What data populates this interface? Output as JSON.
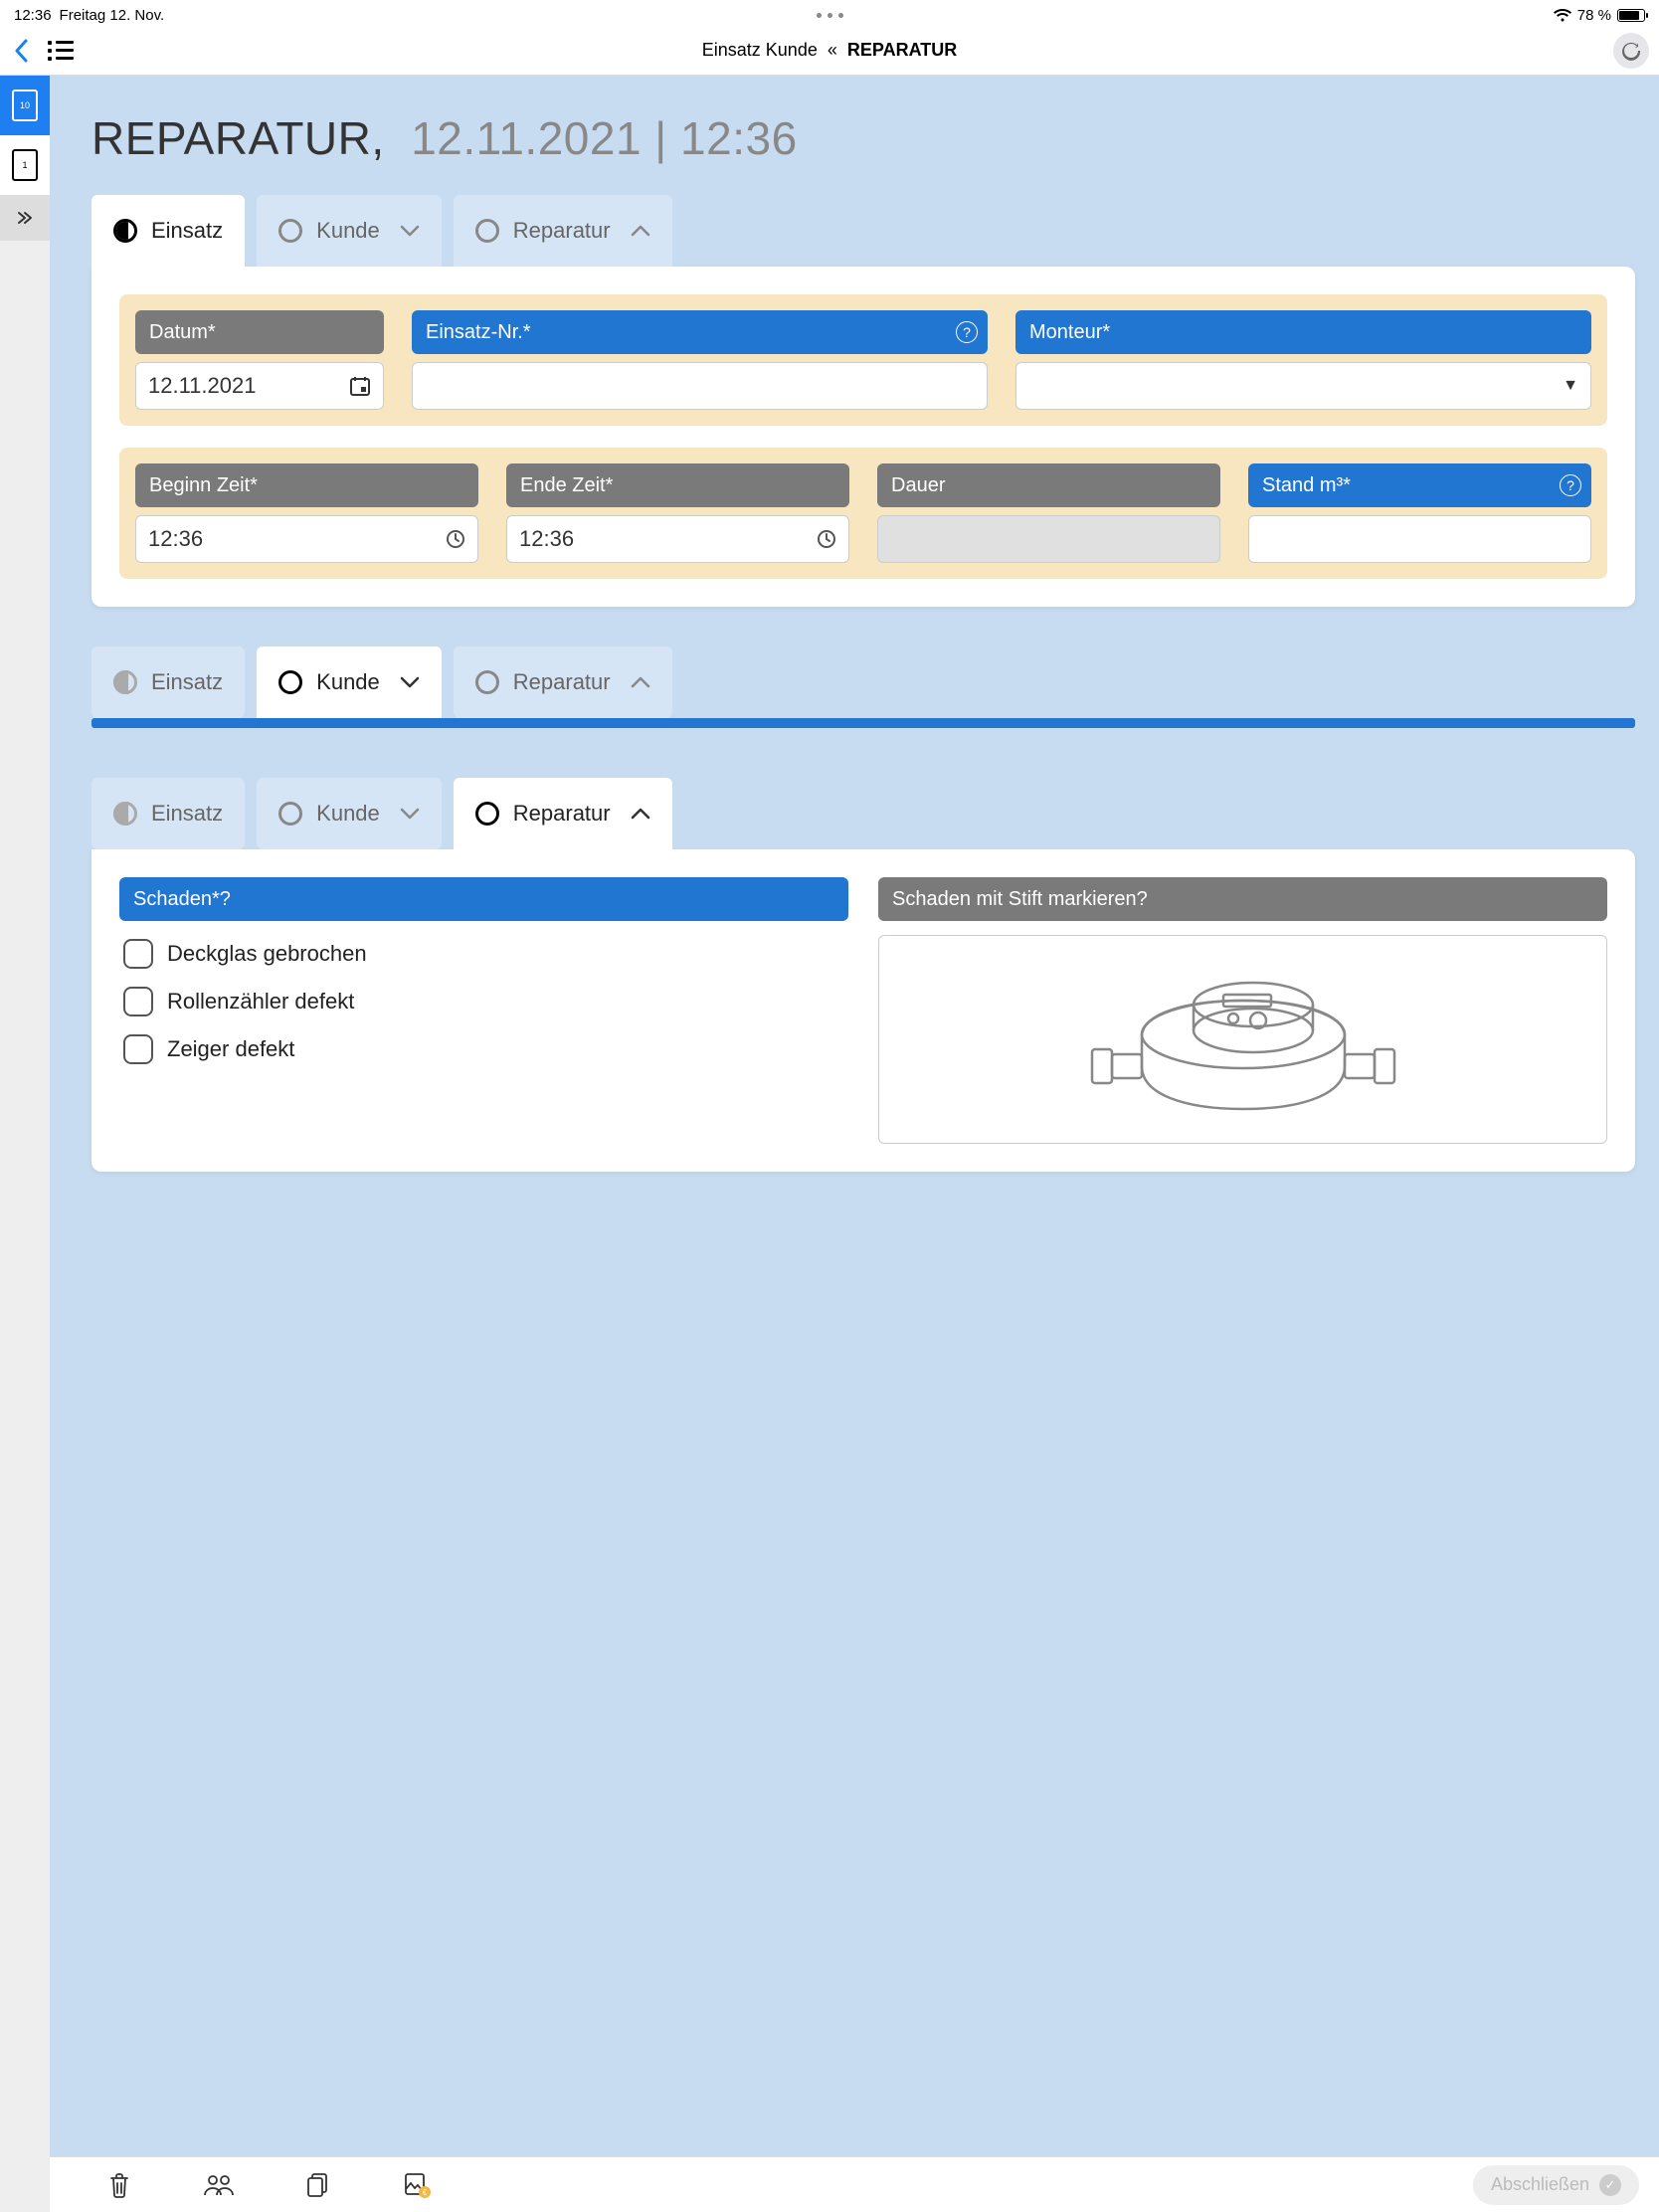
{
  "status": {
    "time": "12:36",
    "date": "Freitag 12. Nov.",
    "battery_pct": "78 %"
  },
  "nav": {
    "title_prefix": "Einsatz Kunde",
    "title_sep": "«",
    "title_main": "REPARATUR"
  },
  "sidebar": {
    "doc1_badge": "10",
    "doc2_badge": "1"
  },
  "page_title": {
    "name": "REPARATUR,",
    "datetime": "12.11.2021 | 12:36"
  },
  "tabs": {
    "einsatz": "Einsatz",
    "kunde": "Kunde",
    "reparatur": "Reparatur"
  },
  "einsatz": {
    "datum_label": "Datum*",
    "datum_value": "12.11.2021",
    "nr_label": "Einsatz-Nr.*",
    "nr_value": "",
    "monteur_label": "Monteur*",
    "monteur_value": "",
    "beginn_label": "Beginn Zeit*",
    "beginn_value": "12:36",
    "ende_label": "Ende Zeit*",
    "ende_value": "12:36",
    "dauer_label": "Dauer",
    "dauer_value": "",
    "stand_label": "Stand m³*",
    "stand_value": ""
  },
  "reparatur": {
    "schaden_label": "Schaden*",
    "mark_label": "Schaden mit Stift markieren",
    "options": {
      "o1": "Deckglas gebrochen",
      "o2": "Rollenzähler defekt",
      "o3": "Zeiger defekt"
    }
  },
  "bottom": {
    "finish": "Abschließen"
  }
}
